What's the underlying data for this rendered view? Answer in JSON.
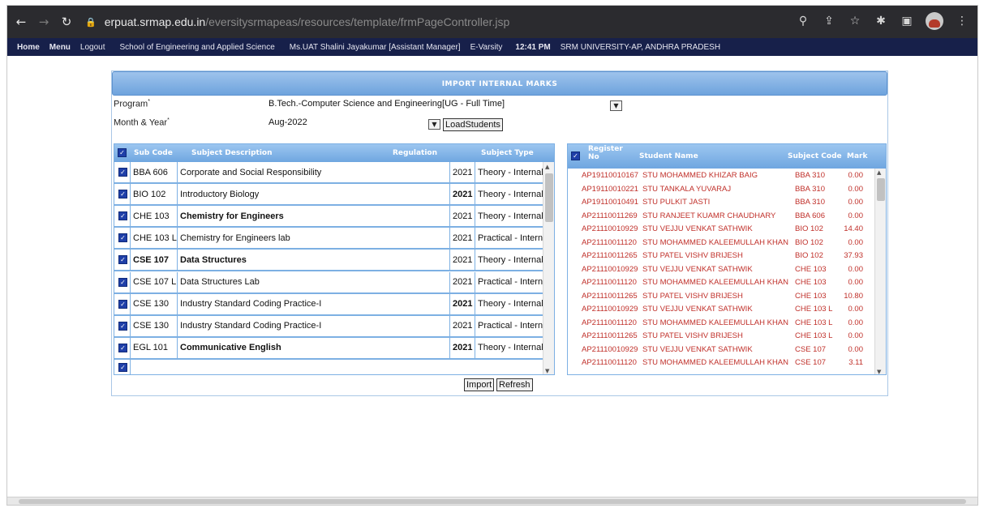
{
  "browser": {
    "url_host": "erpuat.srmap.edu.in",
    "url_path": "/eversitysrmapeas/resources/template/frmPageController.jsp"
  },
  "appbar": {
    "home": "Home",
    "menu": "Menu",
    "logout": "Logout",
    "school": "School of Engineering and Applied Science",
    "user": "Ms.UAT Shalini Jayakumar [Assistant Manager]",
    "app": "E-Varsity",
    "time": "12:41 PM",
    "university": "SRM UNIVERSITY-AP, ANDHRA PRADESH"
  },
  "form": {
    "title": "IMPORT INTERNAL MARKS",
    "program_label": "Program",
    "program_value": "B.Tech.-Computer Science and Engineering[UG - Full Time]",
    "month_label": "Month & Year",
    "month_value": "Aug-2022",
    "load_button": "LoadStudents",
    "import_button": "Import",
    "refresh_button": "Refresh"
  },
  "subjects": {
    "headers": [
      "Sub Code",
      "Subject Description",
      "Regulation",
      "Subject Type"
    ],
    "rows": [
      {
        "code": "BBA 606",
        "desc": "Corporate and Social Responsibility",
        "reg": "2021",
        "type": "Theory - Internal"
      },
      {
        "code": "BIO 102",
        "desc": "Introductory Biology",
        "reg": "2021",
        "type": "Theory - Internal"
      },
      {
        "code": "CHE 103",
        "desc": "Chemistry for Engineers",
        "reg": "2021",
        "type": "Theory - Internal"
      },
      {
        "code": "CHE 103 L",
        "desc": "Chemistry for Engineers lab",
        "reg": "2021",
        "type": "Practical - Internal"
      },
      {
        "code": "CSE 107",
        "desc": "Data Structures",
        "reg": "2021",
        "type": "Theory - Internal"
      },
      {
        "code": "CSE 107 L",
        "desc": "Data Structures Lab",
        "reg": "2021",
        "type": "Practical - Internal"
      },
      {
        "code": "CSE 130",
        "desc": "Industry Standard Coding Practice-I",
        "reg": "2021",
        "type": "Theory - Internal"
      },
      {
        "code": "CSE 130",
        "desc": "Industry Standard Coding Practice-I",
        "reg": "2021",
        "type": "Practical - Internal"
      },
      {
        "code": "EGL 101",
        "desc": "Communicative English",
        "reg": "2021",
        "type": "Theory - Internal"
      }
    ]
  },
  "marks": {
    "headers": [
      "Register No",
      "Student Name",
      "Subject Code",
      "Mark"
    ],
    "rows": [
      {
        "reg": "AP19110010167",
        "name": "STU MOHAMMED KHIZAR BAIG",
        "sub": "BBA 310",
        "mark": "0.00"
      },
      {
        "reg": "AP19110010221",
        "name": "STU TANKALA YUVARAJ",
        "sub": "BBA 310",
        "mark": "0.00"
      },
      {
        "reg": "AP19110010491",
        "name": "STU PULKIT JASTI",
        "sub": "BBA 310",
        "mark": "0.00"
      },
      {
        "reg": "AP21110011269",
        "name": "STU RANJEET KUAMR CHAUDHARY",
        "sub": "BBA 606",
        "mark": "0.00"
      },
      {
        "reg": "AP21110010929",
        "name": "STU VEJJU VENKAT SATHWIK",
        "sub": "BIO 102",
        "mark": "14.40"
      },
      {
        "reg": "AP21110011120",
        "name": "STU MOHAMMED KALEEMULLAH KHAN",
        "sub": "BIO 102",
        "mark": "0.00"
      },
      {
        "reg": "AP21110011265",
        "name": "STU PATEL VISHV BRIJESH",
        "sub": "BIO 102",
        "mark": "37.93"
      },
      {
        "reg": "AP21110010929",
        "name": "STU VEJJU VENKAT SATHWIK",
        "sub": "CHE 103",
        "mark": "0.00"
      },
      {
        "reg": "AP21110011120",
        "name": "STU MOHAMMED KALEEMULLAH KHAN",
        "sub": "CHE 103",
        "mark": "0.00"
      },
      {
        "reg": "AP21110011265",
        "name": "STU PATEL VISHV BRIJESH",
        "sub": "CHE 103",
        "mark": "10.80"
      },
      {
        "reg": "AP21110010929",
        "name": "STU VEJJU VENKAT SATHWIK",
        "sub": "CHE 103 L",
        "mark": "0.00"
      },
      {
        "reg": "AP21110011120",
        "name": "STU MOHAMMED KALEEMULLAH KHAN",
        "sub": "CHE 103 L",
        "mark": "0.00"
      },
      {
        "reg": "AP21110011265",
        "name": "STU PATEL VISHV BRIJESH",
        "sub": "CHE 103 L",
        "mark": "0.00"
      },
      {
        "reg": "AP21110010929",
        "name": "STU VEJJU VENKAT SATHWIK",
        "sub": "CSE 107",
        "mark": "0.00"
      },
      {
        "reg": "AP21110011120",
        "name": "STU MOHAMMED KALEEMULLAH KHAN",
        "sub": "CSE 107",
        "mark": "3.11"
      }
    ]
  },
  "icons": [
    "back-arrow-icon",
    "forward-arrow-icon",
    "reload-icon",
    "lock-icon",
    "zoom-icon",
    "share-icon",
    "star-icon",
    "extensions-icon",
    "sidebar-icon",
    "profile-avatar",
    "more-icon",
    "dropdown-arrow-icon",
    "checkbox-checked-icon"
  ],
  "colors": {
    "header_blue": "#6ea3dd",
    "mark_red": "#c0302a",
    "appbar_navy": "#17204a"
  }
}
